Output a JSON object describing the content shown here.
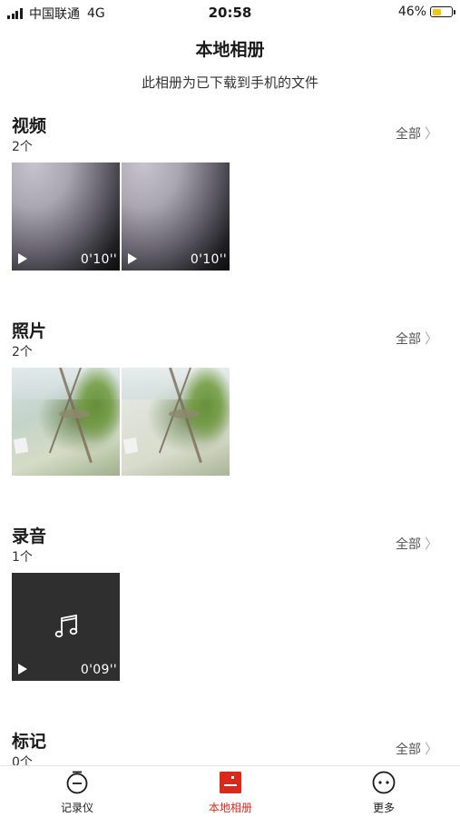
{
  "status_bar": {
    "carrier": "中国联通",
    "network": "4G",
    "time": "20:58",
    "battery_percent": "46%",
    "battery_level": 0.46,
    "battery_color": "#f5c518"
  },
  "header": {
    "title": "本地相册",
    "subtitle": "此相册为已下载到手机的文件"
  },
  "sections": {
    "video": {
      "title": "视频",
      "count": "2个",
      "see_all": "全部",
      "items": [
        {
          "duration": "0'10''"
        },
        {
          "duration": "0'10''"
        }
      ]
    },
    "photo": {
      "title": "照片",
      "count": "2个",
      "see_all": "全部"
    },
    "audio": {
      "title": "录音",
      "count": "1个",
      "see_all": "全部",
      "items": [
        {
          "duration": "0'09''"
        }
      ]
    },
    "marks": {
      "title": "标记",
      "count": "0个",
      "see_all": "全部"
    }
  },
  "tab_bar": {
    "tabs": [
      {
        "label": "记录仪",
        "icon": "recorder-icon"
      },
      {
        "label": "本地相册",
        "icon": "album-icon",
        "active": true
      },
      {
        "label": "更多",
        "icon": "more-icon"
      }
    ],
    "active_color": "#d9281c"
  }
}
